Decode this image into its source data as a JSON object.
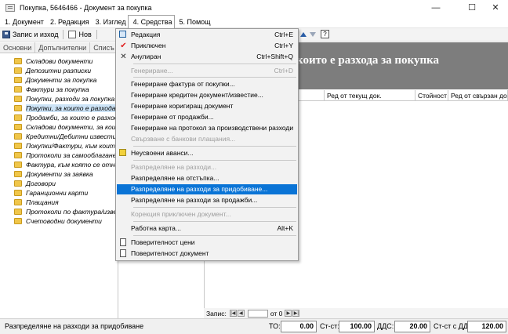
{
  "window": {
    "title": "Покупка, 5646466 - Документ за покупка",
    "minimize": "—",
    "maximize": "☐",
    "close": "✕"
  },
  "menubar": {
    "items": [
      {
        "label": "1. Документ"
      },
      {
        "label": "2. Редакция"
      },
      {
        "label": "3. Изглед"
      },
      {
        "label": "4. Средства"
      },
      {
        "label": "5. Помощ"
      }
    ]
  },
  "toolbar": {
    "save_exit_label": "Запис и изход",
    "new_label": "Нов",
    "help_label": "?"
  },
  "tabs": [
    {
      "label": "Основни"
    },
    {
      "label": "Допълнителни"
    },
    {
      "label": "Списъ"
    }
  ],
  "tree": {
    "items": [
      {
        "label": "Складови документи"
      },
      {
        "label": "Депозитни разписки"
      },
      {
        "label": "Документи за покупка"
      },
      {
        "label": "Фактури за покупка"
      },
      {
        "label": "Покупки, разходи за покупка"
      },
      {
        "label": "Покупки, за които е разхода за"
      },
      {
        "label": "Продажби, за които е разхода"
      },
      {
        "label": "Складови документи, за които"
      },
      {
        "label": "Кредитни/Дебитни известия"
      },
      {
        "label": "Покупки/Фактури, към които"
      },
      {
        "label": "Протоколи за самооблагане"
      },
      {
        "label": "Фактура, към която се отнася"
      },
      {
        "label": "Документи за заявка"
      },
      {
        "label": "Договори"
      },
      {
        "label": "Гаранционни карти"
      },
      {
        "label": "Плащания"
      },
      {
        "label": "Протоколи по фактура/известие"
      },
      {
        "label": "Счетоводни документи"
      }
    ]
  },
  "content": {
    "title": "които е разхода за покупка",
    "columns": [
      {
        "label": "Ред от текущ док."
      },
      {
        "label": "Стойност"
      },
      {
        "label": "Ред от свързан док"
      }
    ]
  },
  "record_bar": {
    "label": "Запис:",
    "of_label": "от 0"
  },
  "dropdown": {
    "items": [
      {
        "label": "Редакция",
        "shortcut": "Ctrl+E",
        "icon": "edit-icon"
      },
      {
        "label": "Приключен",
        "shortcut": "Ctrl+Y",
        "icon": "check-icon"
      },
      {
        "label": "Анулиран",
        "shortcut": "Ctrl+Shift+Q",
        "icon": "cancel-x-icon"
      },
      {
        "label": "Генериране...",
        "shortcut": "Ctrl+D"
      },
      {
        "label": "Генериране фактура от покупки..."
      },
      {
        "label": "Генериране кредитен документ/известие..."
      },
      {
        "label": "Генериране коригиращ документ"
      },
      {
        "label": "Генериране от продажби..."
      },
      {
        "label": "Генериране на протокол за производствени разходи"
      },
      {
        "label": "Свързване с банкови плащания..."
      },
      {
        "label": "Неусвоени аванси...",
        "icon": "advance-icon"
      },
      {
        "label": "Разпределяне на разходи..."
      },
      {
        "label": "Разпределяне на отстъпка..."
      },
      {
        "label": "Разпределяне на разходи за придобиване..."
      },
      {
        "label": "Разпределяне на разходи за продажби..."
      },
      {
        "label": "Корекция приключен документ..."
      },
      {
        "label": "Работна карта...",
        "shortcut": "Alt+K"
      },
      {
        "label": "Поверителност цени",
        "icon": "document-icon"
      },
      {
        "label": "Поверителност документ",
        "icon": "document-icon"
      }
    ]
  },
  "status": {
    "text": "Разпределяне на разходи за придобиване",
    "to_label": "ТО:",
    "to_value": "0.00",
    "st_label": "Ст-ст:",
    "st_value": "100.00",
    "vat_label": "ДДС:",
    "vat_value": "20.00",
    "st_vat_label": "Ст-ст с ДДС:",
    "st_vat_value": "120.00"
  },
  "colors": {
    "highlight": "#0a74d6",
    "banner": "#7d7d7d",
    "folder": "#f0c64a"
  }
}
